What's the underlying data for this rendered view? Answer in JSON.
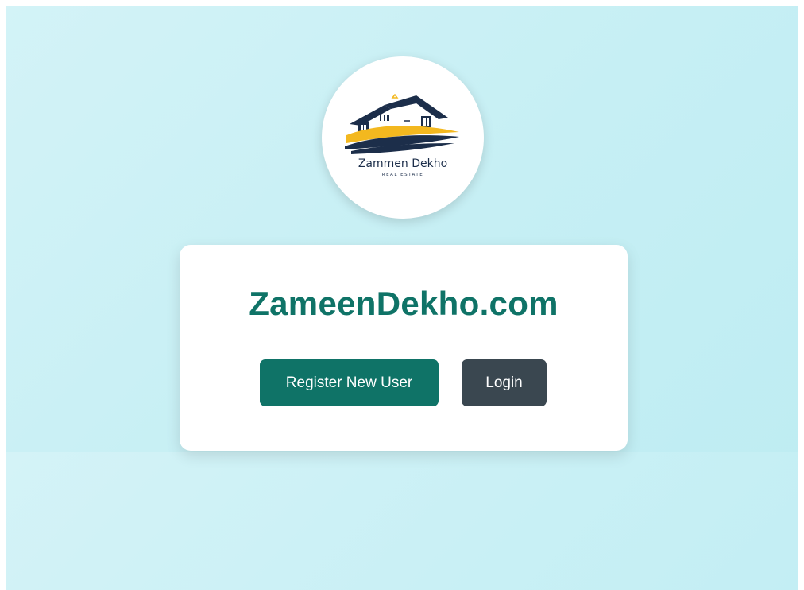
{
  "logo": {
    "brand_name": "Zammen Dekho",
    "tagline": "REAL ESTATE",
    "icon": "house-roof-wave-logo"
  },
  "card": {
    "title": "ZameenDekho.com",
    "register_label": "Register New User",
    "login_label": "Login"
  },
  "colors": {
    "accent": "#0f7367",
    "login_button": "#3a4750",
    "background": "#c6eff4",
    "logo_navy": "#1c2e4a",
    "logo_gold": "#f3b81f"
  }
}
